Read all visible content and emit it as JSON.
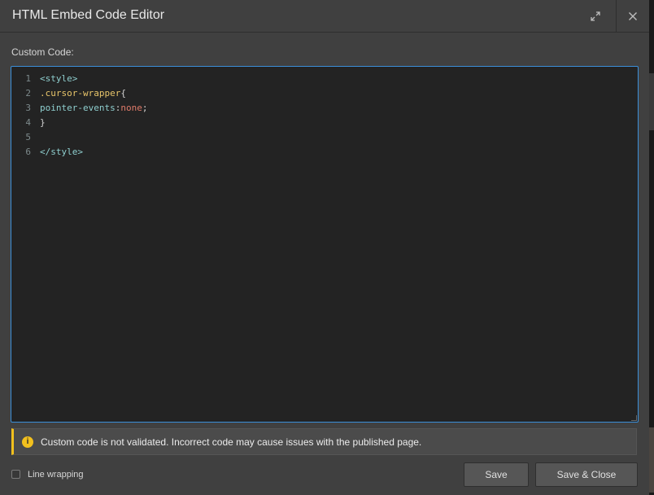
{
  "dialog": {
    "title": "HTML Embed Code Editor",
    "expand_icon": "expand-icon",
    "close_icon": "close-icon"
  },
  "editor": {
    "label": "Custom Code:",
    "lines": [
      {
        "num": "1",
        "tokens": [
          {
            "t": "<style>",
            "c": "tag"
          }
        ]
      },
      {
        "num": "2",
        "tokens": [
          {
            "t": ".cursor-wrapper",
            "c": "sel"
          },
          {
            "t": "{",
            "c": "punct"
          }
        ]
      },
      {
        "num": "3",
        "tokens": [
          {
            "t": "pointer-events",
            "c": "prop"
          },
          {
            "t": ":",
            "c": "punct"
          },
          {
            "t": "none",
            "c": "val"
          },
          {
            "t": ";",
            "c": "punct"
          }
        ]
      },
      {
        "num": "4",
        "tokens": [
          {
            "t": "}",
            "c": "punct"
          }
        ]
      },
      {
        "num": "5",
        "tokens": []
      },
      {
        "num": "6",
        "tokens": [
          {
            "t": "</style>",
            "c": "tag"
          }
        ]
      }
    ]
  },
  "notice": {
    "icon": "info-icon",
    "icon_glyph": "i",
    "text": "Custom code is not validated. Incorrect code may cause issues with the published page."
  },
  "footer": {
    "line_wrapping_label": "Line wrapping",
    "save_label": "Save",
    "save_close_label": "Save & Close"
  },
  "colors": {
    "accent_border": "#3b8fd9",
    "warning": "#f2c01e"
  }
}
